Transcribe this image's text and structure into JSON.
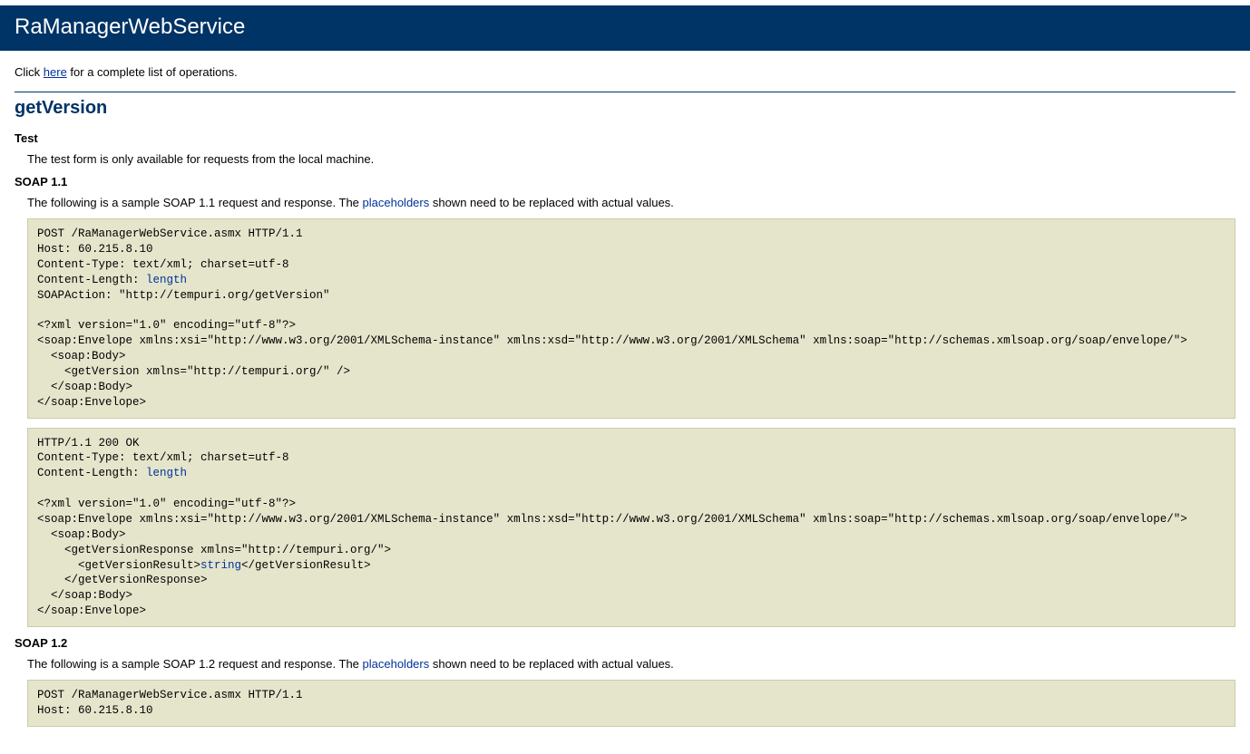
{
  "header": {
    "title": "RaManagerWebService"
  },
  "intro": {
    "prefix": "Click ",
    "link": "here",
    "suffix": " for a complete list of operations."
  },
  "operation": {
    "name": "getVersion"
  },
  "test": {
    "heading": "Test",
    "desc": "The test form is only available for requests from the local machine."
  },
  "soap11": {
    "heading": "SOAP 1.1",
    "desc_prefix": "The following is a sample SOAP 1.1 request and response. The ",
    "desc_ph": "placeholders",
    "desc_suffix": " shown need to be replaced with actual values.",
    "request": {
      "l1": "POST /RaManagerWebService.asmx HTTP/1.1",
      "l2": "Host: 60.215.8.10",
      "l3": "Content-Type: text/xml; charset=utf-8",
      "l4a": "Content-Length: ",
      "l4ph": "length",
      "l5": "SOAPAction: \"http://tempuri.org/getVersion\"",
      "l6": "",
      "l7": "<?xml version=\"1.0\" encoding=\"utf-8\"?>",
      "l8": "<soap:Envelope xmlns:xsi=\"http://www.w3.org/2001/XMLSchema-instance\" xmlns:xsd=\"http://www.w3.org/2001/XMLSchema\" xmlns:soap=\"http://schemas.xmlsoap.org/soap/envelope/\">",
      "l9": "  <soap:Body>",
      "l10": "    <getVersion xmlns=\"http://tempuri.org/\" />",
      "l11": "  </soap:Body>",
      "l12": "</soap:Envelope>"
    },
    "response": {
      "l1": "HTTP/1.1 200 OK",
      "l2": "Content-Type: text/xml; charset=utf-8",
      "l3a": "Content-Length: ",
      "l3ph": "length",
      "l4": "",
      "l5": "<?xml version=\"1.0\" encoding=\"utf-8\"?>",
      "l6": "<soap:Envelope xmlns:xsi=\"http://www.w3.org/2001/XMLSchema-instance\" xmlns:xsd=\"http://www.w3.org/2001/XMLSchema\" xmlns:soap=\"http://schemas.xmlsoap.org/soap/envelope/\">",
      "l7": "  <soap:Body>",
      "l8": "    <getVersionResponse xmlns=\"http://tempuri.org/\">",
      "l9a": "      <getVersionResult>",
      "l9ph": "string",
      "l9b": "</getVersionResult>",
      "l10": "    </getVersionResponse>",
      "l11": "  </soap:Body>",
      "l12": "</soap:Envelope>"
    }
  },
  "soap12": {
    "heading": "SOAP 1.2",
    "desc_prefix": "The following is a sample SOAP 1.2 request and response. The ",
    "desc_ph": "placeholders",
    "desc_suffix": " shown need to be replaced with actual values.",
    "request": {
      "l1": "POST /RaManagerWebService.asmx HTTP/1.1",
      "l2": "Host: 60.215.8.10"
    }
  }
}
